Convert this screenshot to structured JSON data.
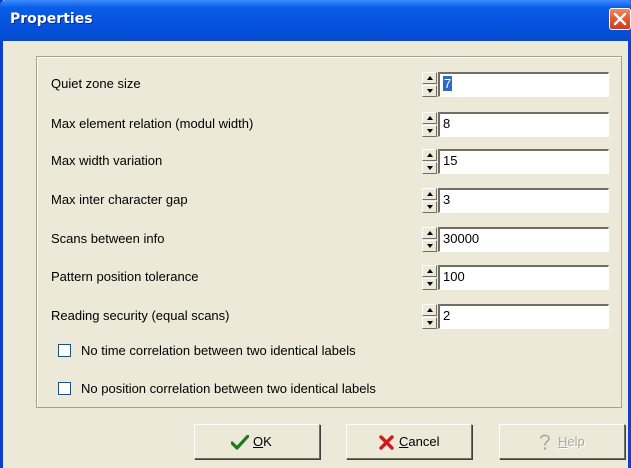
{
  "window": {
    "title": "Properties"
  },
  "fields": [
    {
      "label": "Quiet zone size",
      "value": "7",
      "selected": true
    },
    {
      "label": "Max element relation (modul width)",
      "value": "8"
    },
    {
      "label": "Max width variation",
      "value": "15"
    },
    {
      "label": "Max inter character gap",
      "value": "3"
    },
    {
      "label": "Scans between info",
      "value": "30000"
    },
    {
      "label": "Pattern position tolerance",
      "value": "100"
    },
    {
      "label": "Reading security (equal scans)",
      "value": "2"
    }
  ],
  "checkboxes": [
    {
      "label": "No time correlation between two identical labels",
      "checked": false
    },
    {
      "label": "No position correlation between two identical labels",
      "checked": false
    }
  ],
  "buttons": {
    "ok": {
      "mnemonic": "O",
      "rest": "K",
      "icon": "checkmark-icon",
      "color": "#1b7a1b"
    },
    "cancel": {
      "mnemonic": "C",
      "rest": "ancel",
      "icon": "x-mark-icon",
      "color": "#c81e1e"
    },
    "help": {
      "mnemonic": "H",
      "rest": "elp",
      "icon": "question-mark-icon",
      "enabled": false
    }
  },
  "colors": {
    "titlebar": "#0a5ee8",
    "selection": "#316ac5",
    "dialog_bg": "#ece9d8"
  }
}
